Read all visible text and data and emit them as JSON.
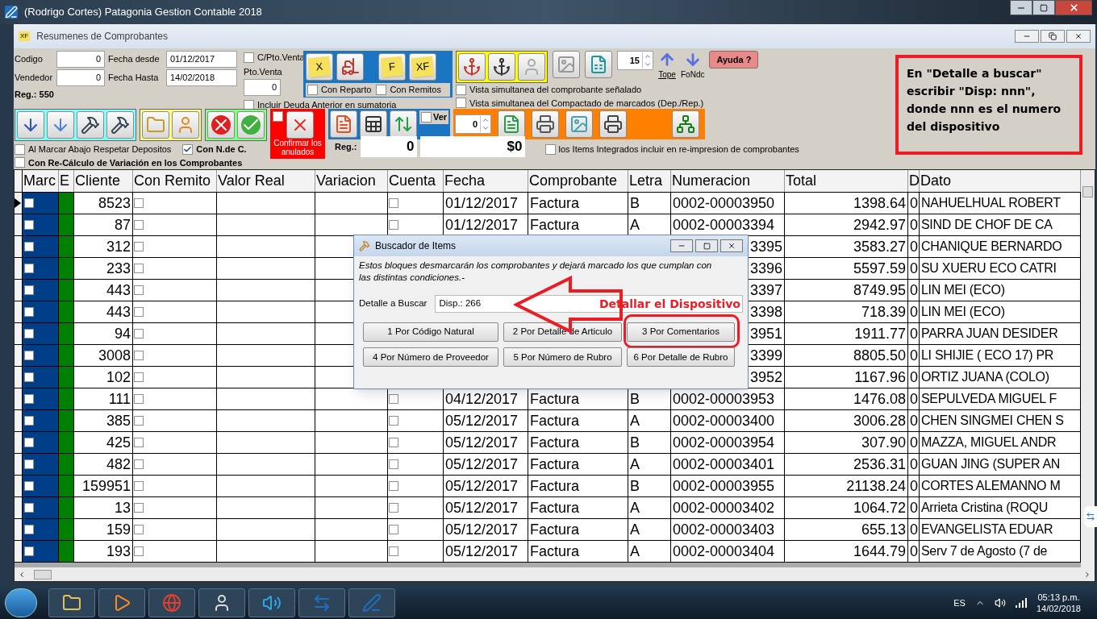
{
  "window": {
    "title": "(Rodrigo Cortes) Patagonia Gestion Contable 2018"
  },
  "child_window": {
    "title": "Resumenes de Comprobantes",
    "icon_text": "XF"
  },
  "filters": {
    "codigo": {
      "label": "Codigo",
      "value": "0"
    },
    "vendedor": {
      "label": "Vendedor",
      "value": "0"
    },
    "fecha_desde": {
      "label": "Fecha desde",
      "value": "01/12/2017"
    },
    "fecha_hasta": {
      "label": "Fecha Hasta",
      "value": "14/02/2018"
    },
    "reg": "Reg.: 550"
  },
  "pto_venta": {
    "checkbox": {
      "label": "C/Pto.Venta",
      "checked": false
    },
    "label": "Pto.Venta",
    "value": "0"
  },
  "incluir_deuda": {
    "label": "Incluir Deuda Anterior en sumatoria",
    "checked": false
  },
  "delivery_group": {
    "notes": [
      "X",
      "F",
      "XF"
    ],
    "checkboxes": [
      {
        "label": "Con Reparto",
        "checked": false
      },
      {
        "label": "Con Remitos",
        "checked": false
      }
    ]
  },
  "vista": [
    {
      "label": "Vista simultanea del comprobante señalado",
      "checked": false
    },
    {
      "label": "Vista simultanea del Compactado de marcados (Dep./Rep.)",
      "checked": false
    }
  ],
  "page_spinner": "15",
  "tope": "Tope",
  "fondc": "FoNdc",
  "help": "Ayuda ?",
  "options": [
    {
      "label": "Al Marcar Abajo Respetar Depositos",
      "checked": false,
      "bold": false
    },
    {
      "label": "Con N.de C.",
      "checked": true,
      "bold": true
    },
    {
      "label": "Con Re-Cálculo de Variación en los Comprobantes",
      "checked": false,
      "bold": true
    }
  ],
  "confirm": {
    "label": "Confirmar los anulados",
    "checked": false
  },
  "ver": {
    "label": "Ver",
    "checked": false
  },
  "copies_spinner": "0",
  "totals": {
    "label": "Reg.:",
    "count": "0",
    "amount": "$0"
  },
  "items_integrados": {
    "label": "los Items Integrados incluir en re-impresion de comprobantes",
    "checked": false
  },
  "annotation": "En \"Detalle a buscar\" escribir \"Disp: nnn\", donde nnn es el numero del dispositivo",
  "table": {
    "columns": [
      {
        "label": "Marc",
        "kind": "mark"
      },
      {
        "label": "E",
        "kind": "flag"
      },
      {
        "label": "Cliente",
        "kind": "num"
      },
      {
        "label": "Con Remito",
        "kind": "check"
      },
      {
        "label": "Valor Real",
        "kind": "num"
      },
      {
        "label": "Variacion",
        "kind": "num"
      },
      {
        "label": "Cuenta",
        "kind": "check"
      },
      {
        "label": "Fecha",
        "kind": "text"
      },
      {
        "label": "Comprobante",
        "kind": "text"
      },
      {
        "label": "Letra",
        "kind": "text"
      },
      {
        "label": "Numeracion",
        "kind": "text"
      },
      {
        "label": "Total",
        "kind": "num"
      },
      {
        "label": "D",
        "kind": "text"
      },
      {
        "label": "Dato",
        "kind": "text"
      }
    ],
    "rows": [
      {
        "selected": true,
        "cells": [
          false,
          null,
          "8523",
          false,
          null,
          null,
          false,
          "01/12/2017",
          "Factura",
          "B",
          "0002-00003950",
          "1398.64",
          "0",
          "NAHUELHUAL ROBERT"
        ]
      },
      {
        "selected": false,
        "cells": [
          false,
          null,
          "87",
          false,
          null,
          null,
          false,
          "01/12/2017",
          "Factura",
          "A",
          "0002-00003394",
          "2942.97",
          "0",
          "SIND DE CHOF DE CA"
        ]
      },
      {
        "selected": false,
        "cells": [
          false,
          null,
          "312",
          false,
          null,
          null,
          null,
          null,
          null,
          null,
          {
            "tail": "3395"
          },
          "3583.27",
          "0",
          "CHANIQUE BERNARDO"
        ]
      },
      {
        "selected": false,
        "cells": [
          false,
          null,
          "233",
          false,
          null,
          null,
          null,
          null,
          null,
          null,
          {
            "tail": "3396"
          },
          "5597.59",
          "0",
          "SU XUERU ECO CATRI"
        ]
      },
      {
        "selected": false,
        "cells": [
          false,
          null,
          "443",
          false,
          null,
          null,
          null,
          null,
          null,
          null,
          {
            "tail": "3397"
          },
          "8749.95",
          "0",
          "LIN MEI (ECO)"
        ]
      },
      {
        "selected": false,
        "cells": [
          false,
          null,
          "443",
          false,
          null,
          null,
          null,
          null,
          null,
          null,
          {
            "tail": "3398"
          },
          "718.39",
          "0",
          "LIN MEI (ECO)"
        ]
      },
      {
        "selected": false,
        "cells": [
          false,
          null,
          "94",
          false,
          null,
          null,
          null,
          null,
          null,
          null,
          {
            "tail": "3951"
          },
          "1911.77",
          "0",
          "PARRA JUAN DESIDER"
        ]
      },
      {
        "selected": false,
        "cells": [
          false,
          null,
          "3008",
          false,
          null,
          null,
          null,
          null,
          null,
          null,
          {
            "tail": "3399"
          },
          "8805.50",
          "0",
          "LI SHIJIE ( ECO 17) PR"
        ]
      },
      {
        "selected": false,
        "cells": [
          false,
          null,
          "102",
          false,
          null,
          null,
          null,
          null,
          null,
          null,
          {
            "tail": "3952"
          },
          "1167.96",
          "0",
          "ORTIZ JUANA (COLO)"
        ]
      },
      {
        "selected": false,
        "cells": [
          false,
          null,
          "111",
          false,
          null,
          null,
          false,
          "04/12/2017",
          "Factura",
          "B",
          "0002-00003953",
          "1476.08",
          "0",
          "SEPULVEDA MIGUEL F"
        ]
      },
      {
        "selected": false,
        "cells": [
          false,
          null,
          "385",
          false,
          null,
          null,
          false,
          "05/12/2017",
          "Factura",
          "A",
          "0002-00003400",
          "3006.28",
          "0",
          "CHEN SINGMEI CHEN S"
        ]
      },
      {
        "selected": false,
        "cells": [
          false,
          null,
          "425",
          false,
          null,
          null,
          false,
          "05/12/2017",
          "Factura",
          "B",
          "0002-00003954",
          "307.90",
          "0",
          "MAZZA, MIGUEL ANDR"
        ]
      },
      {
        "selected": false,
        "cells": [
          false,
          null,
          "482",
          false,
          null,
          null,
          false,
          "05/12/2017",
          "Factura",
          "A",
          "0002-00003401",
          "2536.31",
          "0",
          "GUAN JING (SUPER AN"
        ]
      },
      {
        "selected": false,
        "cells": [
          false,
          null,
          "159951",
          false,
          null,
          null,
          false,
          "05/12/2017",
          "Factura",
          "B",
          "0002-00003955",
          "21138.24",
          "0",
          "CORTES ALEMANNO M"
        ]
      },
      {
        "selected": false,
        "cells": [
          false,
          null,
          "13",
          false,
          null,
          null,
          false,
          "05/12/2017",
          "Factura",
          "A",
          "0002-00003402",
          "1064.72",
          "0",
          "Arrieta Cristina (ROQU"
        ]
      },
      {
        "selected": false,
        "cells": [
          false,
          null,
          "159",
          false,
          null,
          null,
          false,
          "05/12/2017",
          "Factura",
          "A",
          "0002-00003403",
          "655.13",
          "0",
          "EVANGELISTA EDUAR"
        ]
      },
      {
        "selected": false,
        "cells": [
          false,
          null,
          "193",
          false,
          null,
          null,
          false,
          "05/12/2017",
          "Factura",
          "A",
          "0002-00003404",
          "1644.79",
          "0",
          "Serv 7 de Agosto (7 de"
        ]
      }
    ]
  },
  "dialog": {
    "title": "Buscador de Items",
    "description": "Estos bloques desmarcarán los comprobantes y dejará marcado los que cumplan con las distintas condiciones.-",
    "field": {
      "label": "Detalle a Buscar",
      "value": "Disp.: 266"
    },
    "annotation": "Detallar el Dispositivo",
    "buttons": [
      {
        "label": "1 Por Código Natural",
        "circled": false
      },
      {
        "label": "2 Por Detalle de Articulo",
        "circled": false
      },
      {
        "label": "3 Por Comentarios",
        "circled": true
      },
      {
        "label": "4 Por Número de Proveedor",
        "circled": false
      },
      {
        "label": "5 Por Número de Rubro",
        "circled": false
      },
      {
        "label": "6 Por Detalle de Rubro",
        "circled": false
      }
    ]
  },
  "tray": {
    "language": "ES",
    "time": "05:13 p.m.",
    "date": "14/02/2018"
  }
}
